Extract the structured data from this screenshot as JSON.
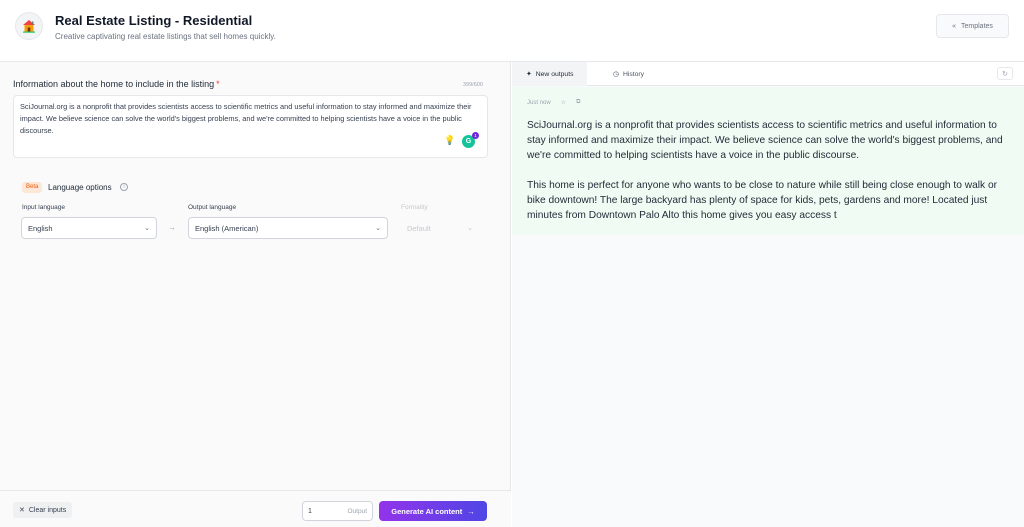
{
  "header": {
    "title": "Real Estate Listing - Residential",
    "subtitle": "Creative captivating real estate listings that sell homes quickly.",
    "templates_label": "Templates"
  },
  "form": {
    "field_label": "Information about the home to include in the listing",
    "required_mark": "*",
    "char_count": "399/600",
    "textarea_value": "SciJournal.org is a nonprofit that provides scientists access to scientific metrics and useful information to stay informed and maximize their impact. We believe science can solve the world's biggest problems, and we're committed to helping scientists have a voice in the public discourse.",
    "grammarly_count": "1"
  },
  "language": {
    "beta_label": "Beta",
    "options_label": "Language options",
    "input_label": "Input language",
    "input_value": "English",
    "output_label": "Output language",
    "output_value": "English (American)",
    "formality_label": "Formality",
    "formality_value": "Default"
  },
  "footer": {
    "clear_label": "Clear inputs",
    "output_count": "1",
    "output_label": "Output",
    "generate_label": "Generate AI content"
  },
  "outputs": {
    "tab_new": "New outputs",
    "tab_history": "History",
    "timestamp": "Just now",
    "paragraphs": [
      "SciJournal.org is a nonprofit that provides scientists access to scientific metrics and useful information to stay informed and maximize their impact. We believe science can solve the world's biggest problems, and we're committed to helping scientists have a voice in the public discourse.",
      "This home is perfect for anyone who wants to be close to nature while still being close enough to walk or bike downtown! The large backyard has plenty of space for kids, pets, gardens and more! Located just minutes from Downtown Palo Alto this home gives you easy access t"
    ]
  },
  "colors": {
    "accent_start": "#9333ea",
    "accent_end": "#4f46e5",
    "output_bg": "#f0fcf3"
  }
}
